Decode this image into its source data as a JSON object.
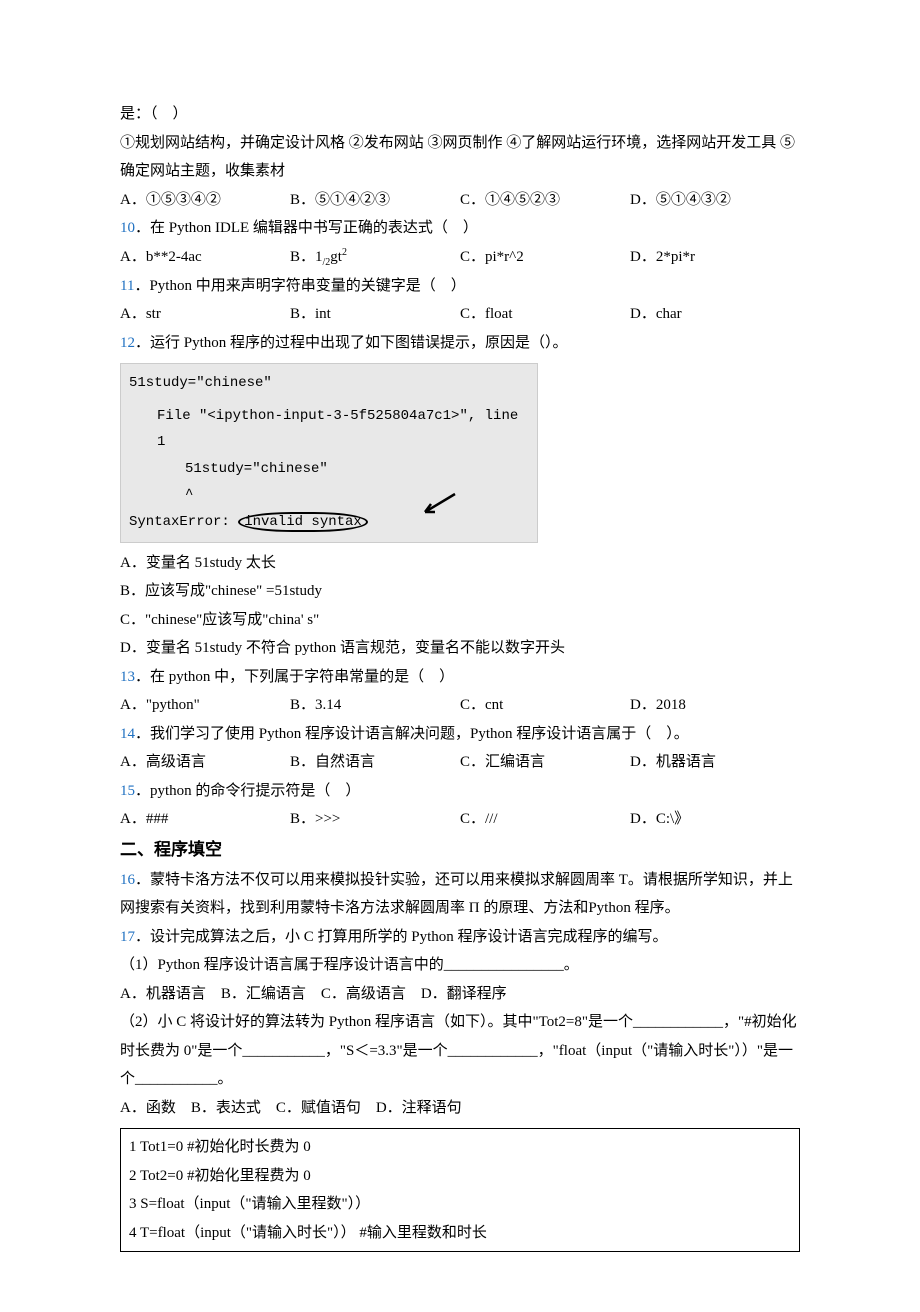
{
  "q9": {
    "stem_line1": "是：（　）",
    "stem_line2": "①规划网站结构，并确定设计风格 ②发布网站 ③网页制作 ④了解网站运行环境，选择网站开发工具 ⑤确定网站主题，收集素材",
    "opts": {
      "A": "A．①⑤③④②",
      "B": "B．⑤①④②③",
      "C": "C．①④⑤②③",
      "D": "D．⑤①④③②"
    }
  },
  "q10": {
    "num": "10",
    "stem": "．在 Python IDLE 编辑器中书写正确的表达式（　）",
    "opts": {
      "A": "A．b**2-4ac",
      "B_pre": "B．1",
      "B_sub": "/2",
      "B_mid": "gt",
      "B_sup": "2",
      "C": "C．pi*r^2",
      "D": "D．2*pi*r"
    }
  },
  "q11": {
    "num": "11",
    "stem": "．Python 中用来声明字符串变量的关键字是（　）",
    "opts": {
      "A": "A．str",
      "B": "B．int",
      "C": "C．float",
      "D": "D．char"
    }
  },
  "q12": {
    "num": "12",
    "stem": "．运行 Python 程序的过程中出现了如下图错误提示，原因是（）。",
    "code": {
      "l1": "51study=\"chinese\"",
      "l2": "File \"<ipython-input-3-5f525804a7c1>\", line 1",
      "l3": "51study=\"chinese\"",
      "l4": "^",
      "l5a": "SyntaxError: ",
      "l5b": "invalid syntax"
    },
    "opts": {
      "A": "A．变量名 51study 太长",
      "B": "B．应该写成\"chinese\" =51study",
      "C": "C．\"chinese\"应该写成\"china' s\"",
      "D": "D．变量名 51study 不符合 python 语言规范，变量名不能以数字开头"
    }
  },
  "q13": {
    "num": "13",
    "stem": "．在 python 中，下列属于字符串常量的是（　）",
    "opts": {
      "A": "A．\"python\"",
      "B": "B．3.14",
      "C": "C．cnt",
      "D": "D．2018"
    }
  },
  "q14": {
    "num": "14",
    "stem": "．我们学习了使用 Python 程序设计语言解决问题，Python 程序设计语言属于（　）。",
    "opts": {
      "A": "A．高级语言",
      "B": "B．自然语言",
      "C": "C．汇编语言",
      "D": "D．机器语言"
    }
  },
  "q15": {
    "num": "15",
    "stem": "．python 的命令行提示符是（　）",
    "opts": {
      "A": "A．###",
      "B": "B．>>>",
      "C": "C．///",
      "D": "D．C:\\》"
    }
  },
  "section2": "二、程序填空",
  "q16": {
    "num": "16",
    "stem": "．蒙特卡洛方法不仅可以用来模拟投针实验，还可以用来模拟求解圆周率 T。请根据所学知识，并上网搜索有关资料，找到利用蒙特卡洛方法求解圆周率 Π 的原理、方法和Python 程序。"
  },
  "q17": {
    "num": "17",
    "stem": "．设计完成算法之后，小 C 打算用所学的 Python 程序设计语言完成程序的编写。",
    "part1": "（1）Python 程序设计语言属于程序设计语言中的________________。",
    "part1_opts": "A．机器语言　B．汇编语言　C．高级语言　D．翻译程序",
    "part2": "（2）小 C 将设计好的算法转为 Python 程序语言（如下）。其中\"Tot2=8\"是一个____________，\"#初始化时长费为 0\"是一个___________，\"S＜=3.3\"是一个____________，\"float（input（\"请输入时长\"））\"是一个___________。",
    "part2_opts": "A．函数　B．表达式　C．赋值语句　D．注释语句",
    "code": {
      "l1": "1 Tot1=0  #初始化时长费为 0",
      "l2": "2 Tot2=0  #初始化里程费为 0",
      "l3": "3 S=float（input（\"请输入里程数\"））",
      "l4": "4 T=float（input（\"请输入时长\"）） #输入里程数和时长"
    }
  }
}
